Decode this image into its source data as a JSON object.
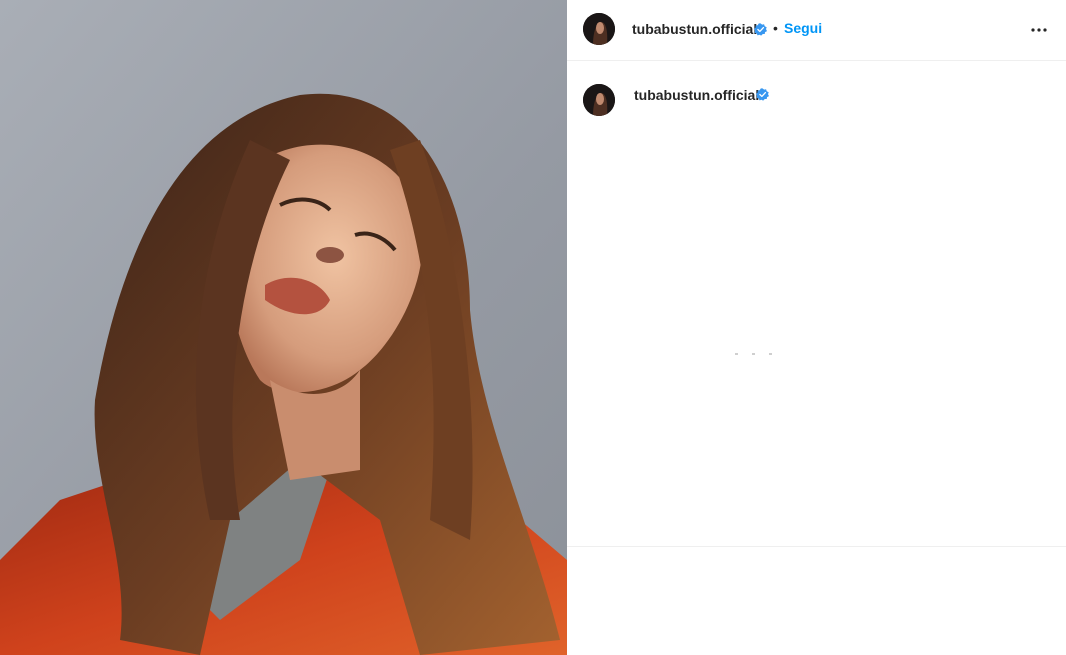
{
  "post": {
    "author": {
      "username": "tubabustun.official",
      "verified": true,
      "avatar_icon": "profile-avatar"
    },
    "header": {
      "separator": "•",
      "follow_label": "Segui",
      "more_icon": "more-horizontal-icon"
    },
    "caption": {
      "username": "tubabustun.official",
      "verified": true
    },
    "media": {
      "type": "photo",
      "colors": {
        "background": "#9ea3ab",
        "hair": "#5b3420",
        "coat": "#c2391a",
        "skin": "#d9a88a"
      }
    }
  },
  "colors": {
    "accent": "#0095f6",
    "text": "#262626",
    "divider": "#efefef",
    "verified_badge": "#3897f0"
  }
}
